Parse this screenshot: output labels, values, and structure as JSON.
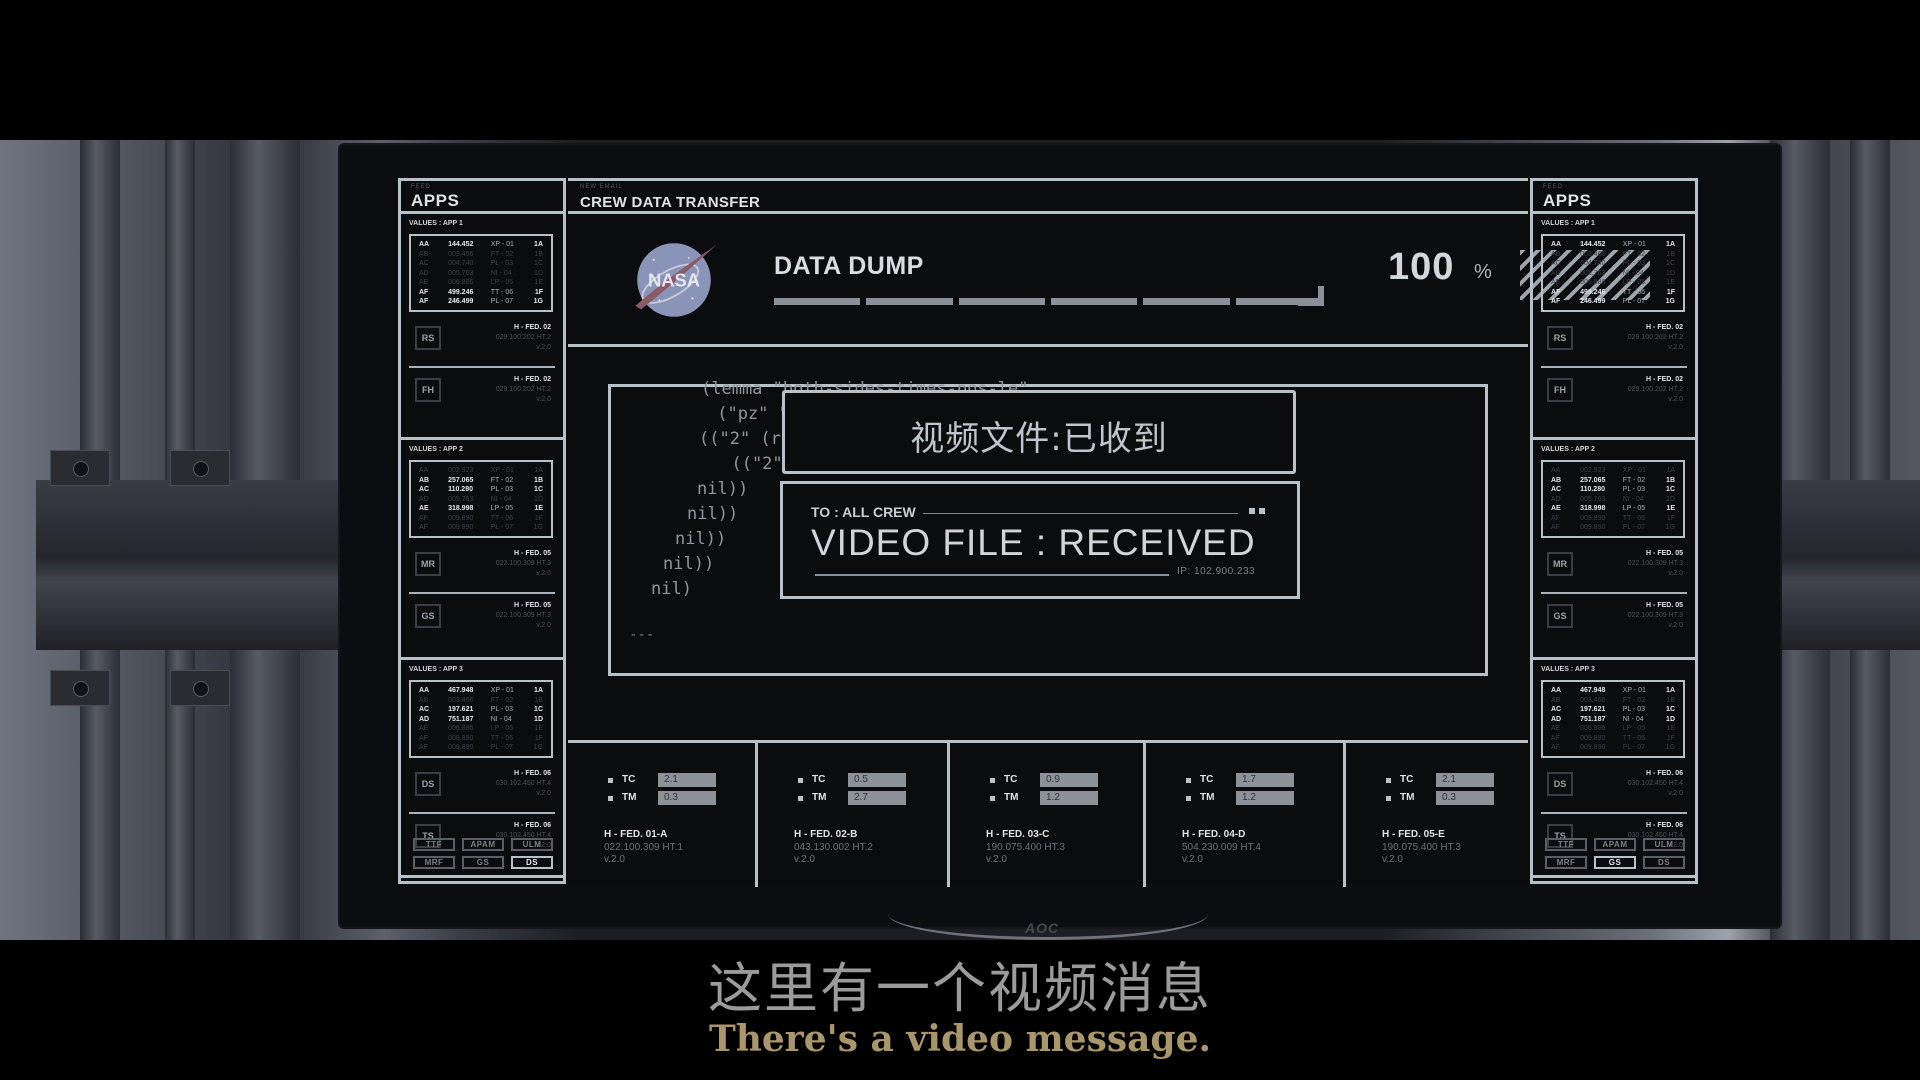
{
  "scene": {
    "monitor_brand": "AOC"
  },
  "left_sidebar": {
    "feed_label": "FEED",
    "title": "APPS",
    "sections": [
      {
        "values_label": "VALUES : APP 1",
        "rows": [
          {
            "c1": "AA",
            "c2": "144.452",
            "c3": "XP - 01",
            "c4": "1A",
            "state": "bright"
          },
          {
            "c1": "AB",
            "c2": "003.466",
            "c3": "FT - 02",
            "c4": "1B",
            "state": "dim"
          },
          {
            "c1": "AC",
            "c2": "004.740",
            "c3": "PL - 03",
            "c4": "1C",
            "state": "dim"
          },
          {
            "c1": "AD",
            "c2": "005.763",
            "c3": "NI - 04",
            "c4": "1D",
            "state": "dim"
          },
          {
            "c1": "AE",
            "c2": "006.886",
            "c3": "LP - 05",
            "c4": "1E",
            "state": "dim"
          },
          {
            "c1": "AF",
            "c2": "499.246",
            "c3": "TT - 06",
            "c4": "1F",
            "state": "bright"
          },
          {
            "c1": "AF",
            "c2": "246.499",
            "c3": "PL - 07",
            "c4": "1G",
            "state": "bright"
          }
        ],
        "feeds": [
          {
            "code": "RS",
            "name": "H - FED. 02",
            "addr": "029.100.202  HT.2",
            "ver": "v.2.0"
          },
          {
            "code": "FH",
            "name": "H - FED. 02",
            "addr": "029.100.202  HT.2",
            "ver": "v.2.0"
          }
        ]
      },
      {
        "values_label": "VALUES : APP 2",
        "rows": [
          {
            "c1": "AA",
            "c2": "002.923",
            "c3": "XP - 01",
            "c4": "1A",
            "state": "dim"
          },
          {
            "c1": "AB",
            "c2": "257.065",
            "c3": "FT - 02",
            "c4": "1B",
            "state": "bright"
          },
          {
            "c1": "AC",
            "c2": "110.280",
            "c3": "PL - 03",
            "c4": "1C",
            "state": "bright"
          },
          {
            "c1": "AD",
            "c2": "005.763",
            "c3": "NI - 04",
            "c4": "1D",
            "state": "dim"
          },
          {
            "c1": "AE",
            "c2": "318.998",
            "c3": "LP - 05",
            "c4": "1E",
            "state": "bright"
          },
          {
            "c1": "AF",
            "c2": "009.890",
            "c3": "TT - 06",
            "c4": "1F",
            "state": "dim"
          },
          {
            "c1": "AF",
            "c2": "009.890",
            "c3": "PL - 07",
            "c4": "1G",
            "state": "dim"
          }
        ],
        "feeds": [
          {
            "code": "MR",
            "name": "H - FED. 05",
            "addr": "022.100.309  HT.3",
            "ver": "v.2.0"
          },
          {
            "code": "GS",
            "name": "H - FED. 05",
            "addr": "022.100.309  HT.3",
            "ver": "v.2.0"
          }
        ]
      },
      {
        "values_label": "VALUES : APP 3",
        "rows": [
          {
            "c1": "AA",
            "c2": "467.948",
            "c3": "XP - 01",
            "c4": "1A",
            "state": "bright"
          },
          {
            "c1": "AB",
            "c2": "003.466",
            "c3": "FT - 02",
            "c4": "1B",
            "state": "dim"
          },
          {
            "c1": "AC",
            "c2": "197.621",
            "c3": "PL - 03",
            "c4": "1C",
            "state": "bright"
          },
          {
            "c1": "AD",
            "c2": "751.187",
            "c3": "NI - 04",
            "c4": "1D",
            "state": "bright"
          },
          {
            "c1": "AE",
            "c2": "006.886",
            "c3": "LP - 05",
            "c4": "1E",
            "state": "dim"
          },
          {
            "c1": "AF",
            "c2": "009.890",
            "c3": "TT - 06",
            "c4": "1F",
            "state": "dim"
          },
          {
            "c1": "AF",
            "c2": "009.890",
            "c3": "PL - 07",
            "c4": "1G",
            "state": "dim"
          }
        ],
        "feeds": [
          {
            "code": "DS",
            "name": "H - FED. 06",
            "addr": "030.102.450  HT.4",
            "ver": "v.2.0"
          },
          {
            "code": "TS",
            "name": "H - FED. 06",
            "addr": "030.102.450  HT.4",
            "ver": "v.2.0"
          }
        ]
      }
    ],
    "buttons": [
      {
        "label": "TTF",
        "active": false
      },
      {
        "label": "APAM",
        "active": false
      },
      {
        "label": "ULM",
        "active": false
      },
      {
        "label": "MRF",
        "active": false
      },
      {
        "label": "GS",
        "active": false
      },
      {
        "label": "DS",
        "active": true
      }
    ]
  },
  "right_sidebar": {
    "feed_label": "FEED",
    "title": "APPS",
    "buttons": [
      {
        "label": "TTF",
        "active": false
      },
      {
        "label": "APAM",
        "active": false
      },
      {
        "label": "ULM",
        "active": false
      },
      {
        "label": "MRF",
        "active": false
      },
      {
        "label": "GS",
        "active": true
      },
      {
        "label": "DS",
        "active": false
      }
    ]
  },
  "main": {
    "header_feed_label": "NEW EMAIL",
    "title": "CREW DATA TRANSFER",
    "logo_text": "NASA",
    "data_dump": {
      "title": "DATA DUMP",
      "progress_percent": 100,
      "percent_value": "100",
      "percent_sign": "%"
    },
    "console": {
      "lines": [
        "(lemma \"both-sides-times-pos-le\"",
        " (\"pz\" \"px",
        "((\"2\" (rew",
        "  ((\"2\" (as",
        "nil))",
        "nil))",
        "nil))",
        "nil))",
        "nil)"
      ],
      "prompt": "---"
    },
    "notice_cn": "视频文件:已收到",
    "notice": {
      "to": "TO : ALL CREW",
      "message": "VIDEO FILE : RECEIVED",
      "ip": "IP: 102.900.233"
    },
    "feeds": [
      {
        "tc_label": "TC",
        "tc": "2.1",
        "tm_label": "TM",
        "tm": "0.3",
        "name": "H - FED. 01-A",
        "addr": "022.100.309  HT.1",
        "ver": "v.2.0"
      },
      {
        "tc_label": "TC",
        "tc": "0.5",
        "tm_label": "TM",
        "tm": "2.7",
        "name": "H - FED. 02-B",
        "addr": "043.130.002  HT.2",
        "ver": "v.2.0"
      },
      {
        "tc_label": "TC",
        "tc": "0.9",
        "tm_label": "TM",
        "tm": "1.2",
        "name": "H - FED. 03-C",
        "addr": "190.075.400  HT.3",
        "ver": "v.2.0"
      },
      {
        "tc_label": "TC",
        "tc": "1.7",
        "tm_label": "TM",
        "tm": "1.2",
        "name": "H - FED. 04-D",
        "addr": "504.230.009  HT.4",
        "ver": "v.2.0"
      },
      {
        "tc_label": "TC",
        "tc": "2.1",
        "tm_label": "TM",
        "tm": "0.3",
        "name": "H - FED. 05-E",
        "addr": "190.075.400  HT.3",
        "ver": "v.2.0"
      }
    ]
  },
  "subtitles": {
    "chinese": "这里有一个视频消息",
    "english": "There's a video message."
  }
}
